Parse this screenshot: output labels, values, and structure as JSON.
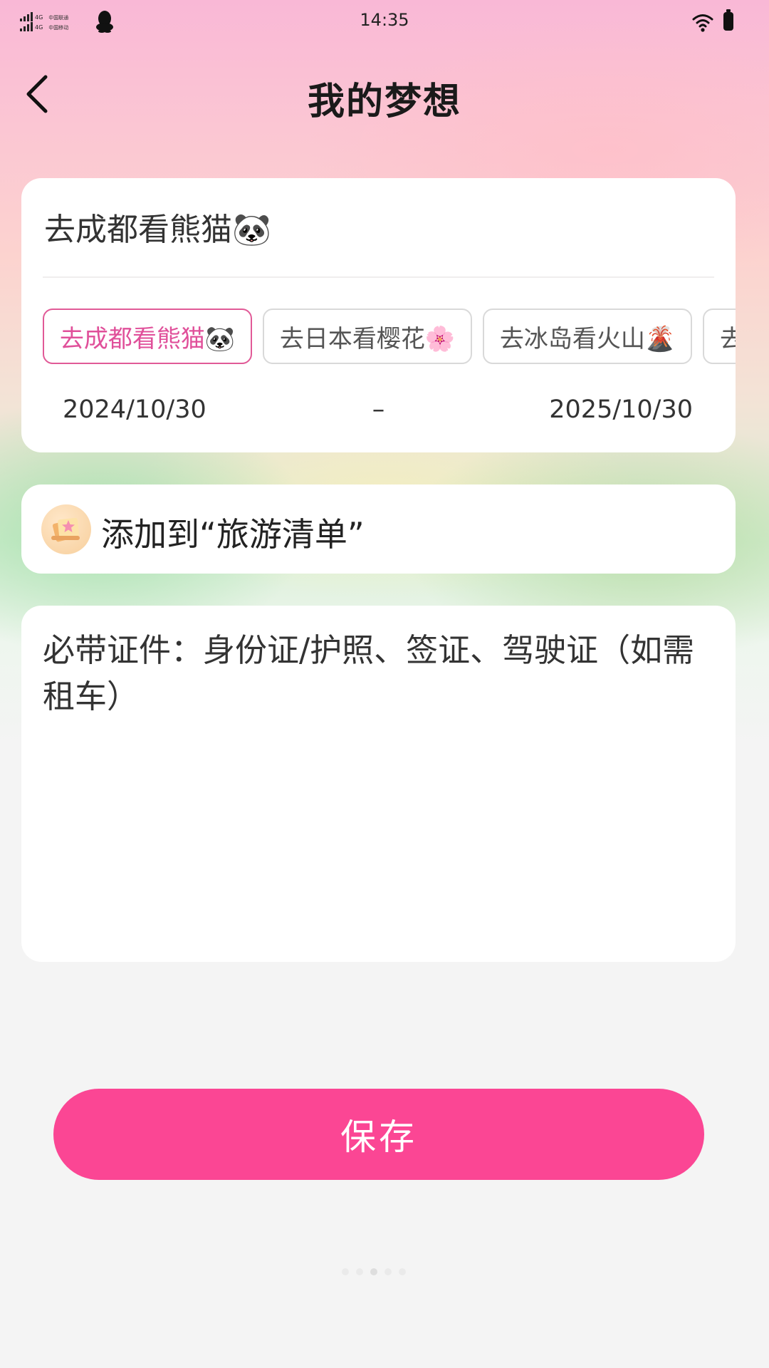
{
  "status_bar": {
    "time": "14:35",
    "network_1": "4G",
    "network_2": "4G",
    "carrier_1": "中国联通",
    "carrier_2": "中国移动",
    "icons": [
      "signal-icon",
      "qq-icon",
      "wifi-icon",
      "battery-icon"
    ]
  },
  "header": {
    "title": "我的梦想",
    "back_icon": "chevron-left-icon"
  },
  "dream": {
    "title": "去成都看熊猫🐼",
    "presets": [
      {
        "label": "去成都看熊猫🐼",
        "selected": true
      },
      {
        "label": "去日本看樱花🌸",
        "selected": false
      },
      {
        "label": "去冰岛看火山🌋",
        "selected": false
      },
      {
        "label": "去",
        "selected": false
      }
    ],
    "start_date": "2024/10/30",
    "separator": "–",
    "end_date": "2025/10/30"
  },
  "travel_list": {
    "label": "添加到“旅游清单”",
    "icon": "book-star-icon"
  },
  "notes": {
    "text": "必带证件：身份证/护照、签证、驾驶证（如需租车）"
  },
  "save_label": "保存",
  "colors": {
    "accent": "#fb4694",
    "chip_active": "#e0509a"
  }
}
